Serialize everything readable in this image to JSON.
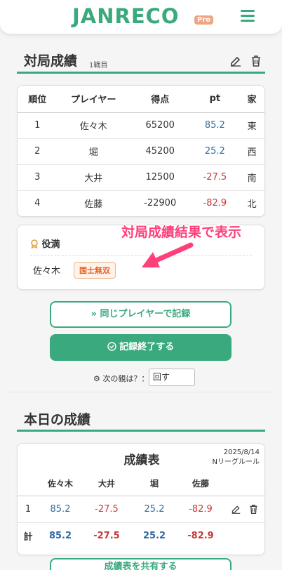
{
  "header": {
    "logo": "JANRECO",
    "pro": "Pro"
  },
  "results_section": {
    "title": "対局成績",
    "subtitle": "1戦目",
    "columns": [
      "順位",
      "プレイヤー",
      "得点",
      "pt",
      "家"
    ],
    "rows": [
      {
        "rank": "1",
        "player": "佐々木",
        "score": "65200",
        "pt": "85.2",
        "seat": "東"
      },
      {
        "rank": "2",
        "player": "堀",
        "score": "45200",
        "pt": "25.2",
        "seat": "西"
      },
      {
        "rank": "3",
        "player": "大井",
        "score": "12500",
        "pt": "-27.5",
        "seat": "南"
      },
      {
        "rank": "4",
        "player": "佐藤",
        "score": "-22900",
        "pt": "-82.9",
        "seat": "北"
      }
    ]
  },
  "yakuman": {
    "heading": "役満",
    "player": "佐々木",
    "yaku": "国士無双"
  },
  "annotation": "対局成績結果で表示",
  "buttons": {
    "same_players": "同じプレイヤーで記録",
    "finish": "記録終了する"
  },
  "next_dealer": {
    "label": "次の親は？：",
    "value": "回す"
  },
  "today_section": {
    "title": "本日の成績",
    "table_title": "成績表",
    "date": "2025/8/14",
    "rule": "Nリーグルール",
    "players": [
      "佐々木",
      "大井",
      "堀",
      "佐藤"
    ],
    "game_rows": [
      {
        "no": "1",
        "values": [
          "85.2",
          "-27.5",
          "25.2",
          "-82.9"
        ]
      }
    ],
    "total": {
      "label": "計",
      "values": [
        "85.2",
        "-27.5",
        "25.2",
        "-82.9"
      ]
    },
    "share_button": "成績表を共有する"
  },
  "colors": {
    "accent": "#3aaa7e",
    "positive": "#2f6aa3",
    "negative": "#c43a3a",
    "annotation": "#ff3f7a",
    "pro_badge": "#f0a582"
  }
}
